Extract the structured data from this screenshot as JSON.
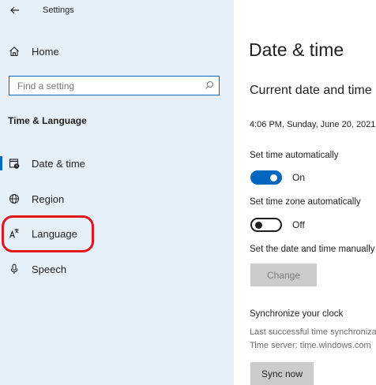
{
  "app": {
    "title": "Settings",
    "back_icon": "back-arrow-icon"
  },
  "sidebar": {
    "home_label": "Home",
    "search_placeholder": "Find a setting",
    "section_title": "Time & Language",
    "items": [
      {
        "label": "Date & time",
        "icon": "clock-calendar-icon",
        "selected": true
      },
      {
        "label": "Region",
        "icon": "globe-icon",
        "selected": false
      },
      {
        "label": "Language",
        "icon": "language-icon",
        "selected": false
      },
      {
        "label": "Speech",
        "icon": "microphone-icon",
        "selected": false
      }
    ]
  },
  "main": {
    "title": "Date & time",
    "section_title": "Current date and time",
    "current_datetime": "4:06 PM, Sunday, June 20, 2021",
    "set_time_auto": {
      "label": "Set time automatically",
      "state": "On",
      "on": true
    },
    "set_timezone_auto": {
      "label": "Set time zone automatically",
      "state": "Off",
      "on": false
    },
    "manual": {
      "label": "Set the date and time manually",
      "button": "Change"
    },
    "sync": {
      "title": "Synchronize your clock",
      "last_sync": "Last successful time synchronization",
      "server": "Time server: time.windows.com",
      "button": "Sync now"
    }
  },
  "colors": {
    "sidebar_bg": "#e6f0f9",
    "accent": "#0067c0",
    "annotation": "#e3161c"
  }
}
